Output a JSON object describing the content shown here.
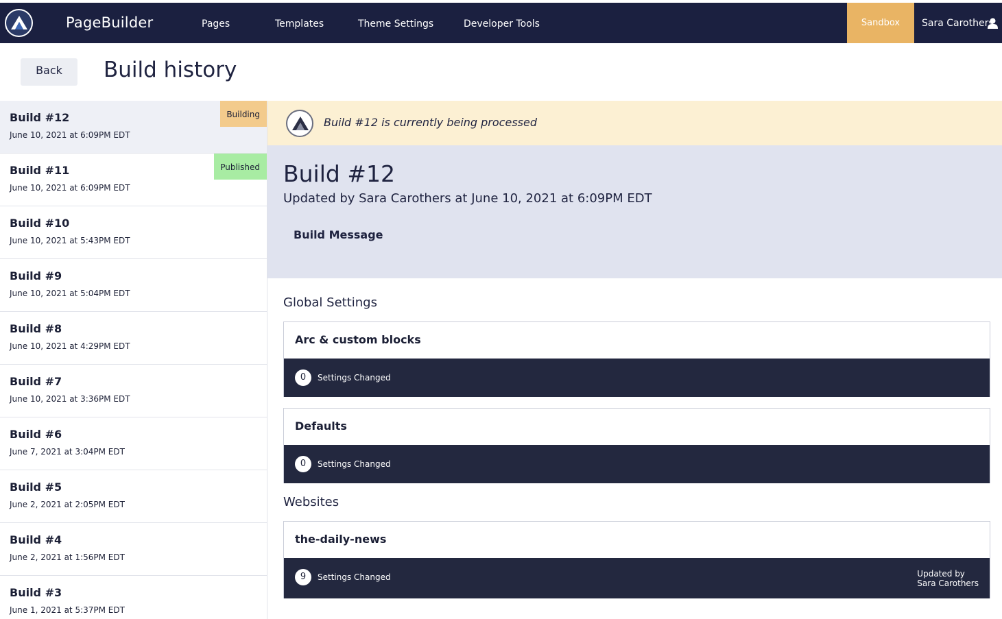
{
  "nav": {
    "brand": "PageBuilder",
    "items": [
      "Pages",
      "Templates",
      "Theme Settings",
      "Developer Tools"
    ],
    "sandbox": "Sandbox",
    "user": "Sara Carothers"
  },
  "header": {
    "back_label": "Back",
    "title": "Build history"
  },
  "builds": [
    {
      "name": "Build #12",
      "date": "June 10, 2021 at 6:09PM EDT",
      "badge": "Building",
      "badge_color": "#f3cb8c"
    },
    {
      "name": "Build #11",
      "date": "June 10, 2021 at 6:09PM EDT",
      "badge": "Published",
      "badge_color": "#a8eca3"
    },
    {
      "name": "Build #10",
      "date": "June 10, 2021 at 5:43PM EDT"
    },
    {
      "name": "Build #9",
      "date": "June 10, 2021 at 5:04PM EDT"
    },
    {
      "name": "Build #8",
      "date": "June 10, 2021 at 4:29PM EDT"
    },
    {
      "name": "Build #7",
      "date": "June 10, 2021 at 3:36PM EDT"
    },
    {
      "name": "Build #6",
      "date": "June 7, 2021 at 3:04PM EDT"
    },
    {
      "name": "Build #5",
      "date": "June 2, 2021 at 2:05PM EDT"
    },
    {
      "name": "Build #4",
      "date": "June 2, 2021 at 1:56PM EDT"
    },
    {
      "name": "Build #3",
      "date": "June 1, 2021 at 5:37PM EDT"
    }
  ],
  "detail": {
    "banner": "Build #12 is currently being processed",
    "title": "Build #12",
    "subtitle": "Updated by Sara Carothers at June 10, 2021 at 6:09PM EDT",
    "message_label": "Build Message",
    "global_settings_title": "Global Settings",
    "websites_title": "Websites",
    "cards": [
      {
        "title": "Arc & custom blocks",
        "count": "0",
        "label": "Settings Changed"
      },
      {
        "title": "Defaults",
        "count": "0",
        "label": "Settings Changed"
      },
      {
        "title": "the-daily-news",
        "count": "9",
        "label": "Settings Changed",
        "updated_by_label": "Updated by",
        "updated_by_name": "Sara Carothers"
      }
    ]
  },
  "colors": {
    "nav_bg": "#1b2040",
    "sandbox": "#e9b464",
    "banner": "#fcf0d3",
    "detail_head": "#e0e3ef",
    "card_footer": "#23283f"
  },
  "icons": {
    "logo": "arc-logo-icon",
    "user": "user-icon"
  }
}
